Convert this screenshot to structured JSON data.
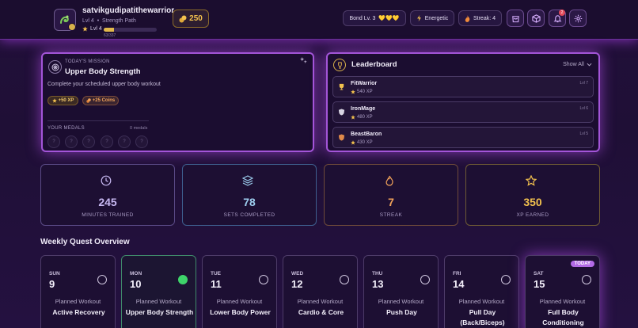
{
  "header": {
    "username": "satvikgudipatithewarrior",
    "level_text": "Lvl 4",
    "separator": "•",
    "path": "Strength Path",
    "level_short": "Lvl 4",
    "xp_text": "63/337",
    "xp_progress": 0.19,
    "coins": "250",
    "bond": "Bond Lv. 3",
    "bond_hearts": "💛💛💛",
    "mood": "Energetic",
    "streak": "Streak: 4",
    "notification_count": "2",
    "icons": [
      "avatar-icon",
      "coin-icon",
      "lightning-icon",
      "flame-icon",
      "shop-icon",
      "cube-icon",
      "bell-icon",
      "gear-icon"
    ]
  },
  "mission": {
    "label": "TODAY'S MISSION",
    "title": "Upper Body Strength",
    "description": "Complete your scheduled upper body workout",
    "xp_reward": "+50 XP",
    "coin_reward": "+25 Coins",
    "medals_label": "YOUR MEDALS",
    "medals_count": "0 medals",
    "medal_slots": [
      "?",
      "?",
      "?",
      "?",
      "?",
      "?"
    ]
  },
  "leaderboard": {
    "title": "Leaderboard",
    "toggle": "Show All",
    "entries": [
      {
        "name": "FitWarrior",
        "xp": "540 XP",
        "level": "Lvl 7",
        "icon": "trophy-gold-icon",
        "color": "#f2c14e"
      },
      {
        "name": "IronMage",
        "xp": "480 XP",
        "level": "Lvl 6",
        "icon": "shield-silver-icon",
        "color": "#d8d4e2"
      },
      {
        "name": "BeastBaron",
        "xp": "430 XP",
        "level": "Lvl 5",
        "icon": "shield-bronze-icon",
        "color": "#e08a4a"
      }
    ]
  },
  "stats": [
    {
      "value": "245",
      "label": "MINUTES TRAINED",
      "icon": "clock-icon",
      "color": "#c7b8f2",
      "border": "#5a4a86"
    },
    {
      "value": "78",
      "label": "SETS COMPLETED",
      "icon": "layers-icon",
      "color": "#9ecff0",
      "border": "#3e5f8e"
    },
    {
      "value": "7",
      "label": "STREAK",
      "icon": "flame-icon",
      "color": "#f0a25a",
      "border": "#6e4a3a"
    },
    {
      "value": "350",
      "label": "XP EARNED",
      "icon": "star-icon",
      "color": "#f2c14e",
      "border": "#6e5a34"
    }
  ],
  "weekly": {
    "title": "Weekly Quest Overview",
    "today_badge": "TODAY",
    "days": [
      {
        "dow": "SUN",
        "num": "9",
        "planned": "Planned Workout",
        "title": "Active Recovery",
        "done": false
      },
      {
        "dow": "MON",
        "num": "10",
        "planned": "Planned Workout",
        "title": "Upper Body Strength",
        "done": true
      },
      {
        "dow": "TUE",
        "num": "11",
        "planned": "Planned Workout",
        "title": "Lower Body Power",
        "done": false
      },
      {
        "dow": "WED",
        "num": "12",
        "planned": "Planned Workout",
        "title": "Cardio & Core",
        "done": false
      },
      {
        "dow": "THU",
        "num": "13",
        "planned": "Planned Workout",
        "title": "Push Day",
        "done": false
      },
      {
        "dow": "FRI",
        "num": "14",
        "planned": "Planned Workout",
        "title": "Pull Day (Back/Biceps)",
        "done": false
      },
      {
        "dow": "SAT",
        "num": "15",
        "planned": "Planned Workout",
        "title": "Full Body Conditioning",
        "done": false,
        "today": true
      }
    ]
  }
}
